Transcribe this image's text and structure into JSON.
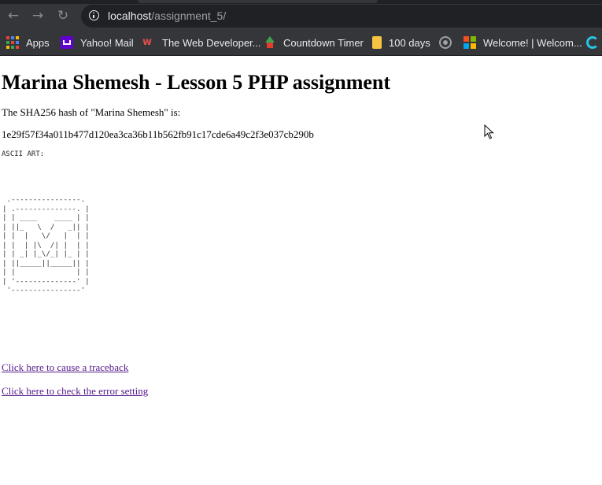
{
  "browser": {
    "url_host": "localhost",
    "url_path": "/assignment_5/",
    "bookmarks": [
      {
        "label": "Apps",
        "icon": "apps-grid-icon"
      },
      {
        "label": "Yahoo! Mail",
        "icon": "yahoo-mail-icon"
      },
      {
        "label": "The Web Developer...",
        "icon": "web-developer-icon"
      },
      {
        "label": "Countdown Timer",
        "icon": "countdown-timer-icon"
      },
      {
        "label": "100 days",
        "icon": "folder-icon"
      },
      {
        "label": "",
        "icon": "globe-icon"
      },
      {
        "label": "Welcome! | Welcom...",
        "icon": "microsoft-icon"
      },
      {
        "label": "",
        "icon": "c-icon"
      }
    ]
  },
  "page": {
    "title": "Marina Shemesh - Lesson 5 PHP assignment",
    "hash_intro": "The SHA256 hash of \"Marina Shemesh\" is:",
    "hash_value": "1e29f57f34a011b477d120ea3ca36b11b562fb91c17cde6a49c2f3e037cb290b",
    "ascii_label": "ASCII ART:",
    "ascii_art": " .----------------.\n| .--------------. |\n| | ____    ____ | |\n| ||_   \\  /   _|| |\n| |  |   \\/   |  | |\n| |  | |\\  /| |  | |\n| | _| |_\\/_| |_ | |\n| ||_____||_____|| |\n| |              | |\n| '--------------' |\n '----------------'",
    "links": [
      "Click here to cause a traceback",
      "Click here to check the error setting"
    ]
  },
  "colors": {
    "chrome_bg": "#35363a",
    "omnibox_bg": "#202124",
    "visited_link": "#551a8b"
  }
}
